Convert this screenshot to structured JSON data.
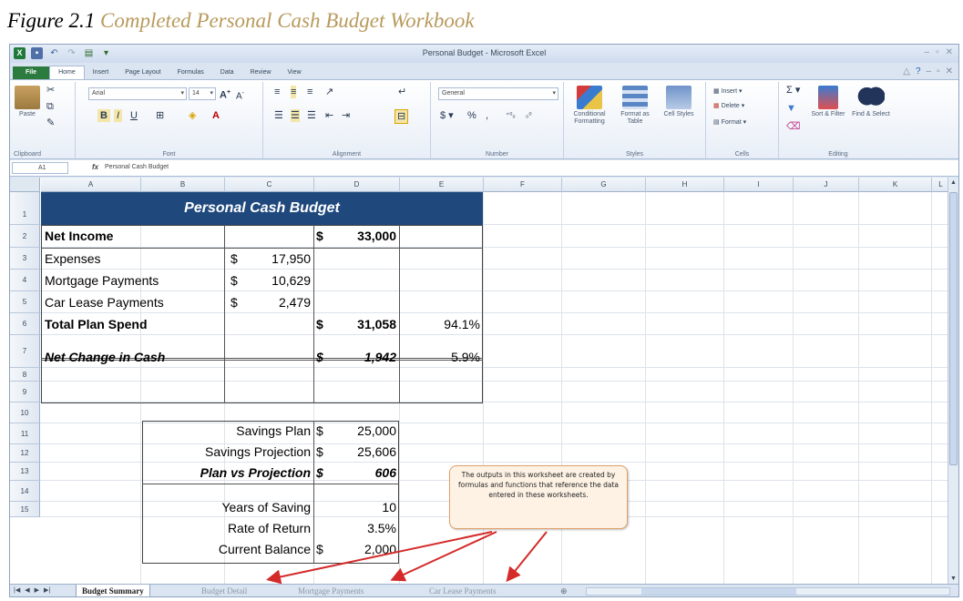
{
  "caption": {
    "number": "Figure 2.1",
    "title": "Completed Personal Cash Budget Workbook"
  },
  "titlebar": {
    "title": "Personal Budget - Microsoft Excel"
  },
  "ribbon_tabs": [
    "File",
    "Home",
    "Insert",
    "Page Layout",
    "Formulas",
    "Data",
    "Review",
    "View"
  ],
  "active_tab": "Home",
  "ribbon": {
    "paste_label": "Paste",
    "font_name": "Arial",
    "font_size": "14",
    "number_format": "General",
    "conditional_formatting": "Conditional Formatting",
    "format_as_table": "Format as Table",
    "cell_styles": "Cell Styles",
    "insert": "Insert",
    "delete": "Delete",
    "format": "Format",
    "sort_filter": "Sort & Filter",
    "find_select": "Find & Select",
    "groups": {
      "clipboard": "Clipboard",
      "font": "Font",
      "alignment": "Alignment",
      "number": "Number",
      "styles": "Styles",
      "cells": "Cells",
      "editing": "Editing"
    }
  },
  "formula_bar": {
    "name_box": "A1",
    "fx": "fx",
    "content": "Personal Cash Budget"
  },
  "columns": [
    "A",
    "B",
    "C",
    "D",
    "E",
    "F",
    "G",
    "H",
    "I",
    "J",
    "K",
    "L"
  ],
  "rows": [
    "1",
    "2",
    "3",
    "4",
    "5",
    "6",
    "7",
    "8",
    "9",
    "10",
    "11",
    "12",
    "13",
    "14",
    "15"
  ],
  "sheet": {
    "header": "Personal Cash Budget",
    "net_income": {
      "label": "Net Income",
      "cur": "$",
      "value": "33,000"
    },
    "expenses": {
      "label": "Expenses",
      "cur": "$",
      "value": "17,950"
    },
    "mortgage": {
      "label": "Mortgage Payments",
      "cur": "$",
      "value": "10,629"
    },
    "car_lease": {
      "label": "Car Lease Payments",
      "cur": "$",
      "value": "2,479"
    },
    "total_spend": {
      "label": "Total Plan Spend",
      "cur": "$",
      "value": "31,058",
      "pct": "94.1%"
    },
    "net_change": {
      "label": "Net Change in Cash",
      "cur": "$",
      "value": "1,942",
      "pct": "5.9%"
    },
    "savings_plan": {
      "label": "Savings Plan",
      "cur": "$",
      "value": "25,000"
    },
    "savings_projection": {
      "label": "Savings Projection",
      "cur": "$",
      "value": "25,606"
    },
    "plan_vs_projection": {
      "label": "Plan vs Projection",
      "cur": "$",
      "value": "606"
    },
    "years_saving": {
      "label": "Years of Saving",
      "value": "10"
    },
    "rate_return": {
      "label": "Rate of Return",
      "value": "3.5%"
    },
    "current_balance": {
      "label": "Current Balance",
      "cur": "$",
      "value": "2,000"
    }
  },
  "callout": "The outputs in this worksheet are created by formulas and functions that reference the data entered in these worksheets.",
  "sheet_tabs": [
    "Budget Summary",
    "Budget Detail",
    "Mortgage Payments",
    "Car Lease Payments"
  ],
  "colors": {
    "header_fill": "#1f497d",
    "caption_title": "#b89a5c",
    "arrow": "#d42a2a",
    "callout_fill": "#fdf2e4"
  }
}
